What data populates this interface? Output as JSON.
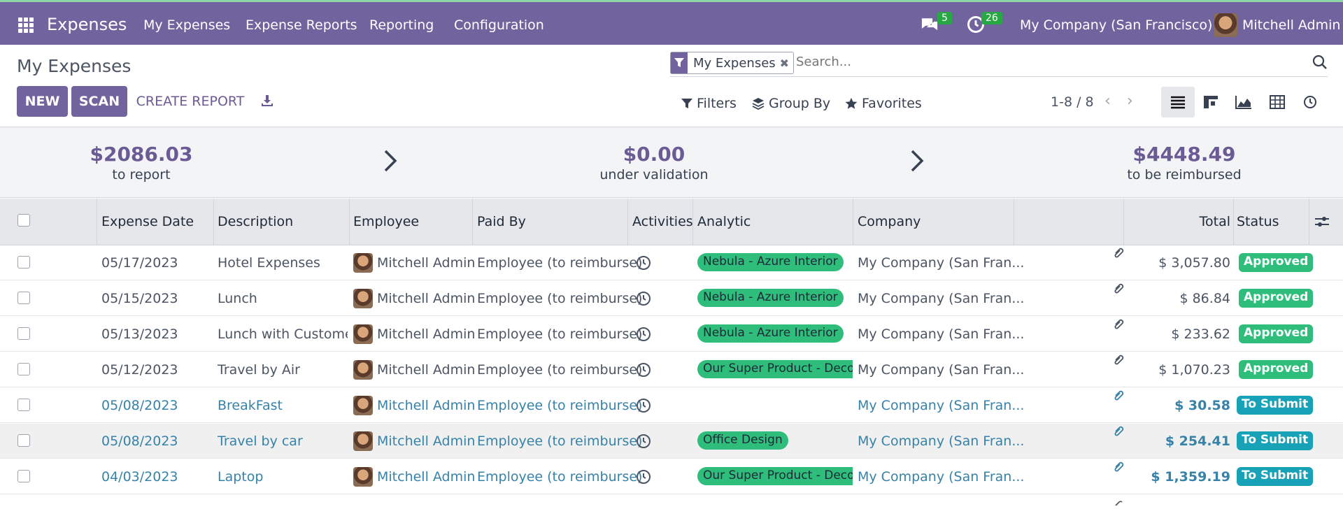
{
  "navbar": {
    "app_name": "Expenses",
    "menu": [
      "My Expenses",
      "Expense Reports",
      "Reporting",
      "Configuration"
    ],
    "messages_count": "5",
    "activities_count": "26",
    "company": "My Company (San Francisco)",
    "user": "Mitchell Admin"
  },
  "page": {
    "title": "My Expenses",
    "new_label": "NEW",
    "scan_label": "SCAN",
    "create_report_label": "CREATE REPORT"
  },
  "search": {
    "facet": "My Expenses",
    "placeholder": "Search...",
    "filters_label": "Filters",
    "group_by_label": "Group By",
    "favorites_label": "Favorites"
  },
  "pager": {
    "text": "1-8 / 8"
  },
  "summary": {
    "to_report_value": "$2086.03",
    "to_report_label": "to report",
    "validation_value": "$0.00",
    "validation_label": "under validation",
    "reimbursed_value": "$4448.49",
    "reimbursed_label": "to be reimbursed"
  },
  "table": {
    "headers": {
      "date": "Expense Date",
      "description": "Description",
      "employee": "Employee",
      "paid_by": "Paid By",
      "activities": "Activities",
      "analytic": "Analytic",
      "company": "Company",
      "total": "Total",
      "status": "Status"
    },
    "rows": [
      {
        "date": "05/17/2023",
        "description": "Hotel Expenses",
        "employee": "Mitchell Admin",
        "paid_by": "Employee (to reimburse)",
        "analytic": "Nebula - Azure Interior",
        "company": "My Company (San Fran...",
        "total": "$ 3,057.80",
        "status": "Approved"
      },
      {
        "date": "05/15/2023",
        "description": "Lunch",
        "employee": "Mitchell Admin",
        "paid_by": "Employee (to reimburse)",
        "analytic": "Nebula - Azure Interior",
        "company": "My Company (San Fran...",
        "total": "$ 86.84",
        "status": "Approved"
      },
      {
        "date": "05/13/2023",
        "description": "Lunch with Customer",
        "employee": "Mitchell Admin",
        "paid_by": "Employee (to reimburse)",
        "analytic": "Nebula - Azure Interior",
        "company": "My Company (San Fran...",
        "total": "$ 233.62",
        "status": "Approved"
      },
      {
        "date": "05/12/2023",
        "description": "Travel by Air",
        "employee": "Mitchell Admin",
        "paid_by": "Employee (to reimburse)",
        "analytic": "Our Super Product - Deco",
        "company": "My Company (San Fran...",
        "total": "$ 1,070.23",
        "status": "Approved"
      },
      {
        "date": "05/08/2023",
        "description": "BreakFast",
        "employee": "Mitchell Admin",
        "paid_by": "Employee (to reimburse)",
        "analytic": "",
        "company": "My Company (San Fran...",
        "total": "$ 30.58",
        "status": "To Submit"
      },
      {
        "date": "05/08/2023",
        "description": "Travel by car",
        "employee": "Mitchell Admin",
        "paid_by": "Employee (to reimburse)",
        "analytic": "Office Design",
        "company": "My Company (San Fran...",
        "total": "$ 254.41",
        "status": "To Submit"
      },
      {
        "date": "04/03/2023",
        "description": "Laptop",
        "employee": "Mitchell Admin",
        "paid_by": "Employee (to reimburse)",
        "analytic": "Our Super Product - Deco",
        "company": "My Company (San Fran...",
        "total": "$ 1,359.19",
        "status": "To Submit"
      }
    ]
  },
  "colors": {
    "brand": "#71639e",
    "approved": "#2ebd7a",
    "to_submit": "#17a2b8",
    "link": "#3682a8"
  }
}
